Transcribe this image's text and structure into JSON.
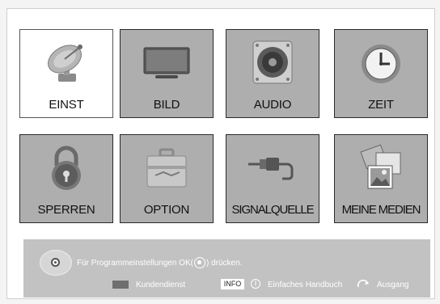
{
  "menu": {
    "tiles": [
      {
        "label": "EINST",
        "icon": "satellite-dish-icon",
        "selected": true
      },
      {
        "label": "BILD",
        "icon": "tv-monitor-icon",
        "selected": false
      },
      {
        "label": "AUDIO",
        "icon": "speaker-icon",
        "selected": false
      },
      {
        "label": "ZEIT",
        "icon": "clock-icon",
        "selected": false
      },
      {
        "label": "SPERREN",
        "icon": "padlock-icon",
        "selected": false
      },
      {
        "label": "OPTION",
        "icon": "toolbox-icon",
        "selected": false
      },
      {
        "label": "SIGNALQUELLE",
        "icon": "cable-plug-icon",
        "selected": false
      },
      {
        "label": "MEINE MEDIEN",
        "icon": "photos-icon",
        "selected": false
      }
    ]
  },
  "footer": {
    "hint_before": "Für Programmeinstellungen OK(",
    "hint_after": ") drücken.",
    "customer_service_label": "Kundendienst",
    "info_key": "INFO",
    "info_symbol": "i",
    "handbook_label": "Einfaches Handbuch",
    "exit_label": "Ausgang"
  },
  "colors": {
    "tile_bg": "#aeaeae",
    "selected_tile_bg": "#ffffff",
    "footer_bg": "#c2c2c2"
  }
}
